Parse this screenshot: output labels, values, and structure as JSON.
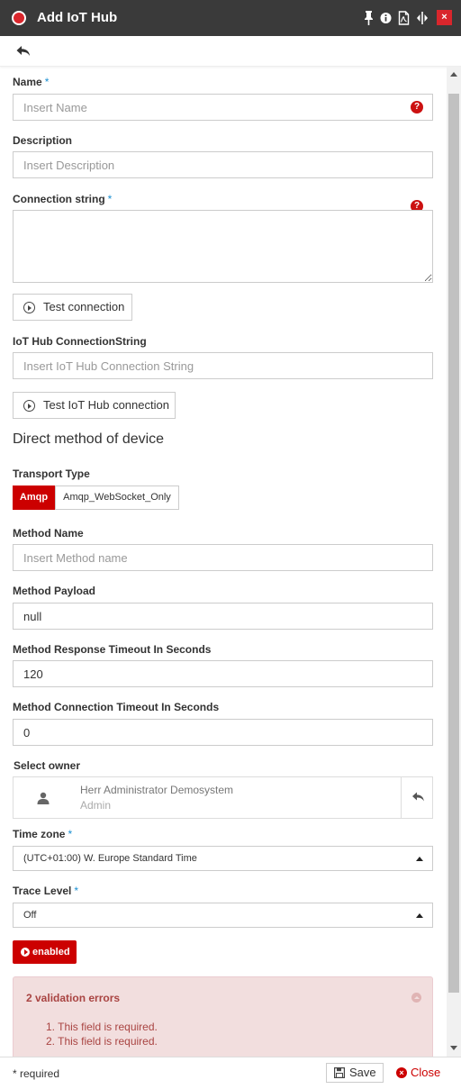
{
  "window": {
    "title": "Add IoT Hub",
    "close_label": "×",
    "icons": [
      "pin-icon",
      "info-icon",
      "pdf-icon",
      "resize-icon",
      "close-icon"
    ]
  },
  "form": {
    "name": {
      "label": "Name",
      "required_mark": "*",
      "placeholder": "Insert Name",
      "value": ""
    },
    "description": {
      "label": "Description",
      "placeholder": "Insert Description",
      "value": ""
    },
    "connection_string": {
      "label": "Connection string",
      "required_mark": "*",
      "value": ""
    },
    "help_glyph": "?",
    "test_connection_label": "Test connection",
    "iot_conn": {
      "label": "IoT Hub ConnectionString",
      "placeholder": "Insert IoT Hub Connection String",
      "value": ""
    },
    "test_iot_label": "Test IoT Hub connection",
    "section_title": "Direct method of device",
    "transport": {
      "label": "Transport Type",
      "options": [
        "Amqp",
        "Amqp_WebSocket_Only"
      ],
      "selected": "Amqp"
    },
    "method_name": {
      "label": "Method Name",
      "placeholder": "Insert Method name",
      "value": ""
    },
    "method_payload": {
      "label": "Method Payload",
      "value": "null"
    },
    "response_timeout": {
      "label": "Method Response Timeout In Seconds",
      "value": "120"
    },
    "connection_timeout": {
      "label": "Method Connection Timeout In Seconds",
      "value": "0"
    },
    "owner": {
      "label": "Select owner",
      "name": "Herr Administrator Demosystem",
      "role": "Admin"
    },
    "timezone": {
      "label": "Time zone",
      "required_mark": "*",
      "value": "(UTC+01:00) W. Europe Standard Time"
    },
    "trace_level": {
      "label": "Trace Level",
      "required_mark": "*",
      "value": "Off"
    },
    "enabled_label": "enabled"
  },
  "validation": {
    "title": "2 validation errors",
    "errors": [
      "1. This field is required.",
      "2. This field is required."
    ]
  },
  "footer": {
    "required_note": "* required",
    "save_label": "Save",
    "close_label": "Close",
    "close_glyph": "×"
  },
  "colors": {
    "titlebar": "#3a3a3a",
    "accent_red": "#cc0000",
    "required_blue": "#1b8fd1",
    "error_bg": "#f2dede",
    "error_text": "#a94442"
  }
}
